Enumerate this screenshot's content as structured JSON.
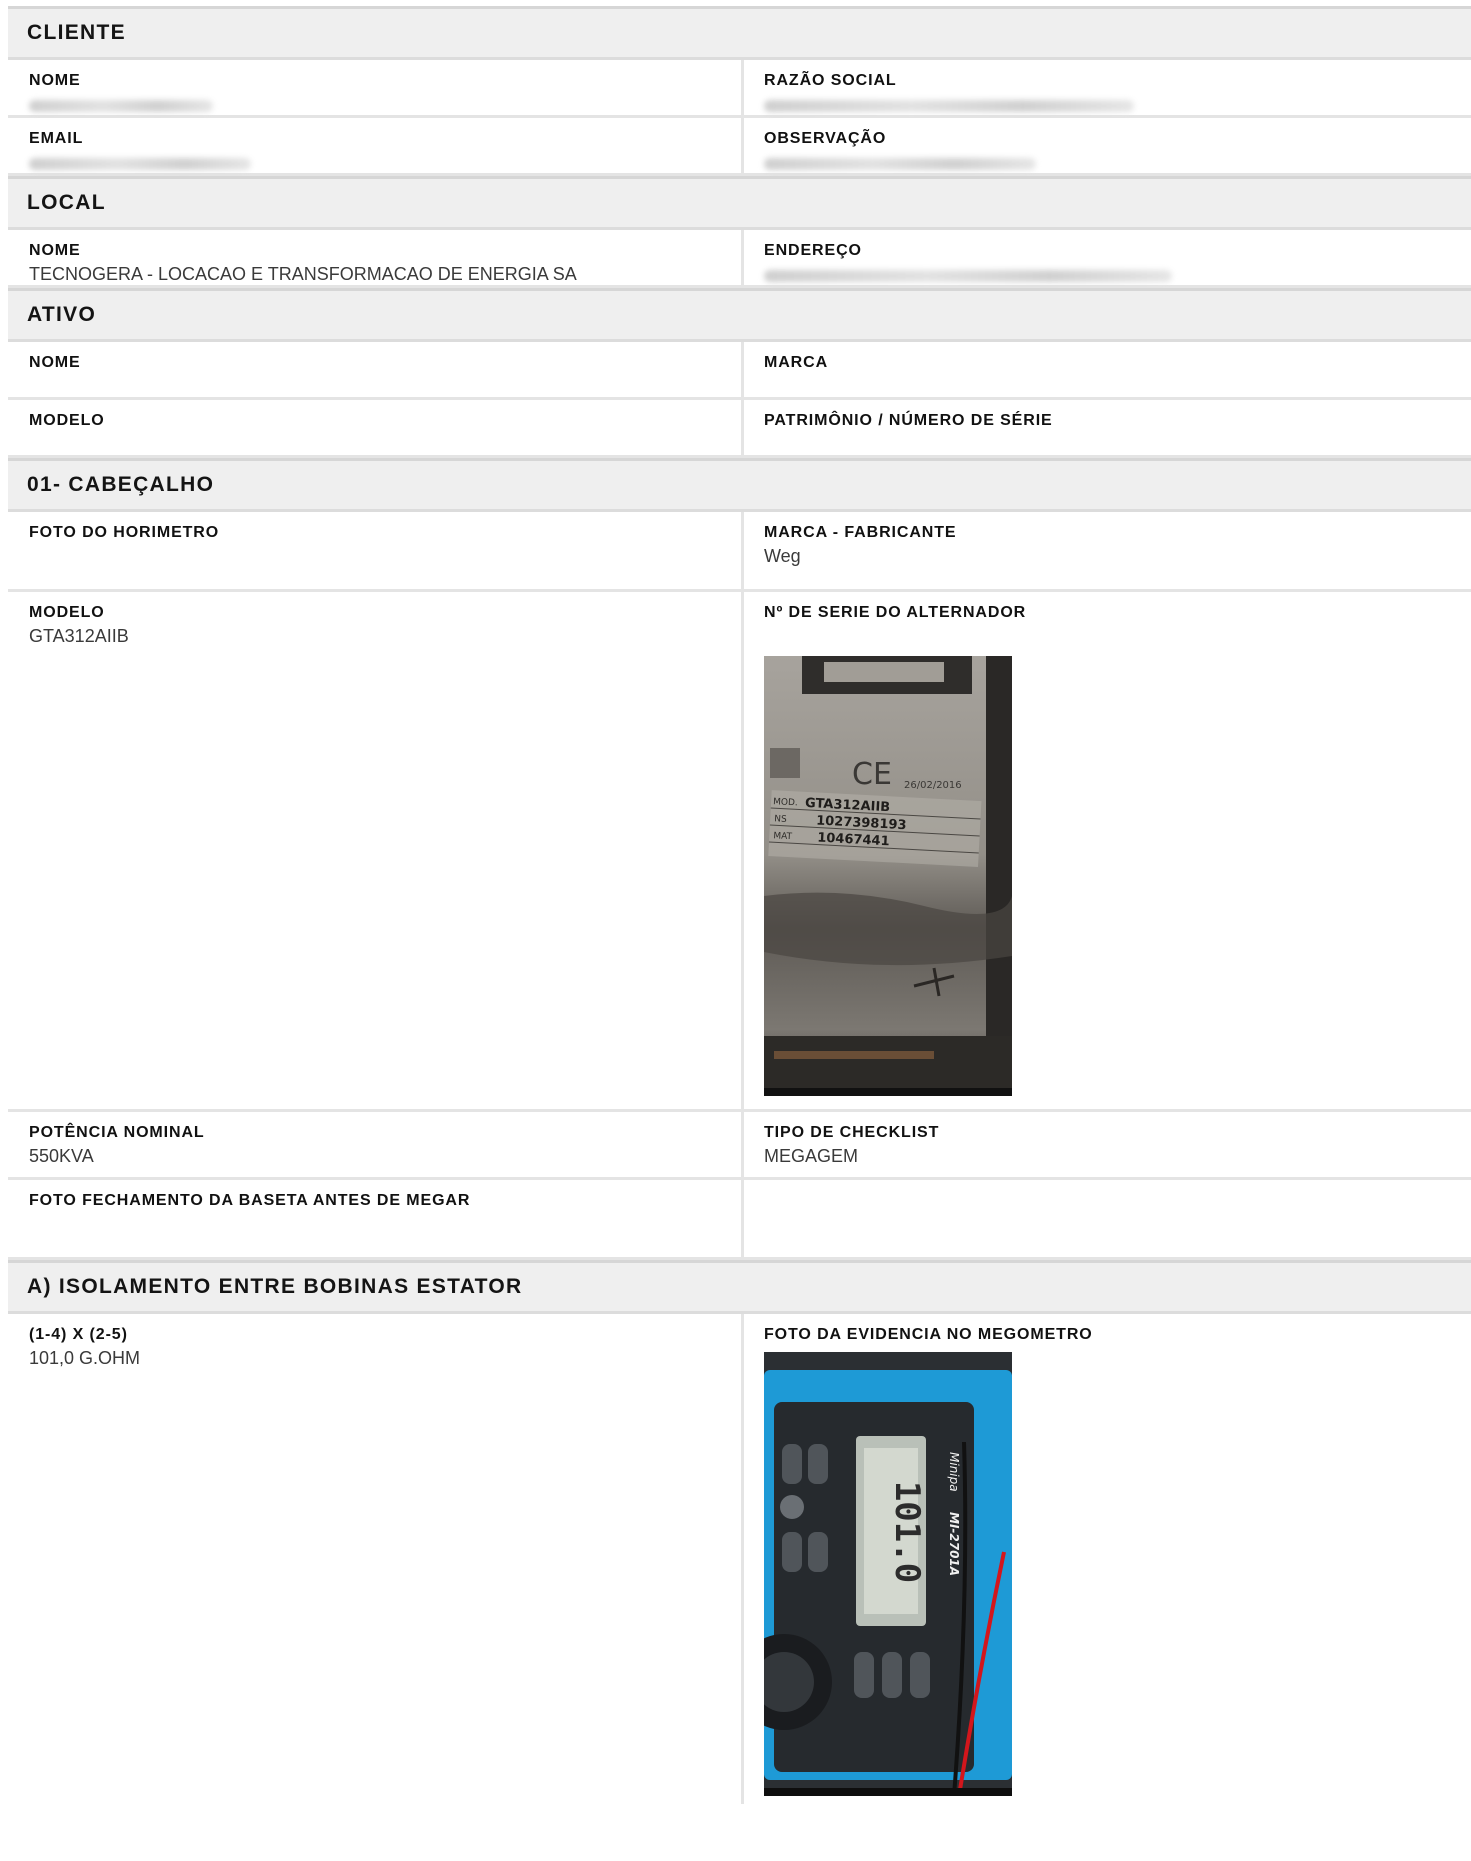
{
  "cliente": {
    "title": "CLIENTE",
    "nome_label": "NOME",
    "razao_label": "RAZÃO SOCIAL",
    "email_label": "EMAIL",
    "obs_label": "OBSERVAÇÃO"
  },
  "local": {
    "title": "LOCAL",
    "nome_label": "NOME",
    "nome_value": "TECNOGERA - LOCACAO E TRANSFORMACAO DE ENERGIA SA",
    "endereco_label": "ENDEREÇO"
  },
  "ativo": {
    "title": "ATIVO",
    "nome_label": "NOME",
    "marca_label": "MARCA",
    "modelo_label": "MODELO",
    "patrimonio_label": "PATRIMÔNIO / NÚMERO DE SÉRIE"
  },
  "cabecalho": {
    "title": "01- CABEÇALHO",
    "foto_horimetro_label": "FOTO DO HORIMETRO",
    "marca_label": "MARCA - FABRICANTE",
    "marca_value": "Weg",
    "modelo_label": "MODELO",
    "modelo_value": "GTA312AIIB",
    "serie_label": "Nº DE SERIE DO ALTERNADOR",
    "plate": {
      "date": "26/02/2016",
      "mod_label": "MOD.",
      "mod_value": "GTA312AIIB",
      "ns_label": "NS",
      "ns_value": "1027398193",
      "mat_label": "MAT",
      "mat_value": "10467441"
    },
    "potencia_label": "POTÊNCIA NOMINAL",
    "potencia_value": "550KVA",
    "tipo_label": "TIPO DE CHECKLIST",
    "tipo_value": "MEGAGEM",
    "foto_baseta_label": "FOTO FECHAMENTO DA BASETA ANTES DE MEGAR"
  },
  "isolamento": {
    "title": "A) ISOLAMENTO ENTRE BOBINAS ESTATOR",
    "medida_label": "(1-4) X (2-5)",
    "medida_value": "101,0 G.OHM",
    "foto_label": "FOTO DA EVIDENCIA NO MEGOMETRO",
    "meter": {
      "brand": "Minipa",
      "model": "MI-2701A",
      "reading": "101.0"
    }
  },
  "colors": {
    "header_bg": "#efefef",
    "border": "#e4e4e4",
    "meter_blue": "#1e9ad6"
  }
}
